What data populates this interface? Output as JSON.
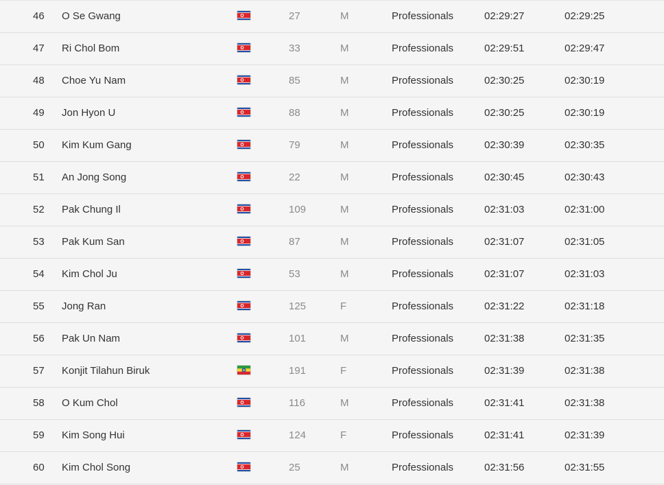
{
  "table": {
    "rows": [
      {
        "place": "46",
        "name": "O Se Gwang",
        "flag": "north-korea-flag-icon",
        "bib": "27",
        "sex": "M",
        "category": "Professionals",
        "gun_time": "02:29:27",
        "net_time": "02:29:25"
      },
      {
        "place": "47",
        "name": "Ri Chol Bom",
        "flag": "north-korea-flag-icon",
        "bib": "33",
        "sex": "M",
        "category": "Professionals",
        "gun_time": "02:29:51",
        "net_time": "02:29:47"
      },
      {
        "place": "48",
        "name": "Choe Yu Nam",
        "flag": "north-korea-flag-icon",
        "bib": "85",
        "sex": "M",
        "category": "Professionals",
        "gun_time": "02:30:25",
        "net_time": "02:30:19"
      },
      {
        "place": "49",
        "name": "Jon Hyon U",
        "flag": "north-korea-flag-icon",
        "bib": "88",
        "sex": "M",
        "category": "Professionals",
        "gun_time": "02:30:25",
        "net_time": "02:30:19"
      },
      {
        "place": "50",
        "name": "Kim Kum Gang",
        "flag": "north-korea-flag-icon",
        "bib": "79",
        "sex": "M",
        "category": "Professionals",
        "gun_time": "02:30:39",
        "net_time": "02:30:35"
      },
      {
        "place": "51",
        "name": "An Jong Song",
        "flag": "north-korea-flag-icon",
        "bib": "22",
        "sex": "M",
        "category": "Professionals",
        "gun_time": "02:30:45",
        "net_time": "02:30:43"
      },
      {
        "place": "52",
        "name": "Pak Chung Il",
        "flag": "north-korea-flag-icon",
        "bib": "109",
        "sex": "M",
        "category": "Professionals",
        "gun_time": "02:31:03",
        "net_time": "02:31:00"
      },
      {
        "place": "53",
        "name": "Pak Kum San",
        "flag": "north-korea-flag-icon",
        "bib": "87",
        "sex": "M",
        "category": "Professionals",
        "gun_time": "02:31:07",
        "net_time": "02:31:05"
      },
      {
        "place": "54",
        "name": "Kim Chol Ju",
        "flag": "north-korea-flag-icon",
        "bib": "53",
        "sex": "M",
        "category": "Professionals",
        "gun_time": "02:31:07",
        "net_time": "02:31:03"
      },
      {
        "place": "55",
        "name": "Jong Ran",
        "flag": "north-korea-flag-icon",
        "bib": "125",
        "sex": "F",
        "category": "Professionals",
        "gun_time": "02:31:22",
        "net_time": "02:31:18"
      },
      {
        "place": "56",
        "name": "Pak Un Nam",
        "flag": "north-korea-flag-icon",
        "bib": "101",
        "sex": "M",
        "category": "Professionals",
        "gun_time": "02:31:38",
        "net_time": "02:31:35"
      },
      {
        "place": "57",
        "name": "Konjit Tilahun Biruk",
        "flag": "ethiopia-flag-icon",
        "bib": "191",
        "sex": "F",
        "category": "Professionals",
        "gun_time": "02:31:39",
        "net_time": "02:31:38"
      },
      {
        "place": "58",
        "name": "O Kum Chol",
        "flag": "north-korea-flag-icon",
        "bib": "116",
        "sex": "M",
        "category": "Professionals",
        "gun_time": "02:31:41",
        "net_time": "02:31:38"
      },
      {
        "place": "59",
        "name": "Kim Song Hui",
        "flag": "north-korea-flag-icon",
        "bib": "124",
        "sex": "F",
        "category": "Professionals",
        "gun_time": "02:31:41",
        "net_time": "02:31:39"
      },
      {
        "place": "60",
        "name": "Kim Chol Song",
        "flag": "north-korea-flag-icon",
        "bib": "25",
        "sex": "M",
        "category": "Professionals",
        "gun_time": "02:31:56",
        "net_time": "02:31:55"
      }
    ]
  },
  "colors": {
    "background": "#f5f5f5",
    "row_divider": "#dedede",
    "text_primary": "#333333",
    "text_muted": "#8a8a8a"
  }
}
